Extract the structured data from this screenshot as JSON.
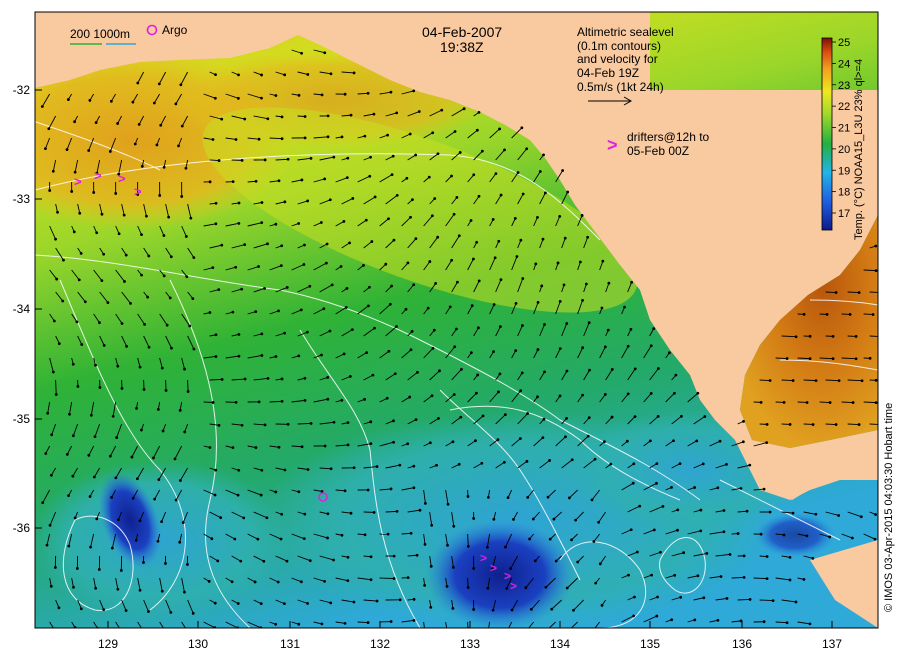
{
  "map": {
    "date": "04-Feb-2007",
    "time": "19:38Z",
    "scale_label": "200 1000m",
    "argo_label": "Argo",
    "altimetry_text": [
      "Altimetric sealevel",
      "(0.1m contours)",
      "and velocity for",
      "04-Feb 19Z",
      "0.5m/s (1kt 24h)"
    ],
    "drifters_text": [
      "drifters@12h to",
      "05-Feb 00Z"
    ],
    "drifter_glyph": ">",
    "colorbar_label": "Temp. (°C) NOAA15_L3U 23% ql>=4",
    "colorbar_ticks": [
      "17",
      "18",
      "19",
      "20",
      "21",
      "22",
      "23",
      "24",
      "25"
    ],
    "credit": "© IMOS 03-Apr-2015 04:03:30 Hobart time",
    "lat_ticks": [
      "-32",
      "-33",
      "-34",
      "-35",
      "-36"
    ],
    "lon_ticks": [
      "129",
      "130",
      "131",
      "132",
      "133",
      "134",
      "135",
      "136",
      "137"
    ],
    "colors": {
      "land": "#f9c9a0",
      "warm": "#e8a020",
      "mid": "#27b336",
      "cool": "#2ea9d8",
      "cold": "#1a2fa8",
      "drifter": "#e020e0",
      "contour": "#ffffff",
      "arrow": "#000000"
    }
  }
}
